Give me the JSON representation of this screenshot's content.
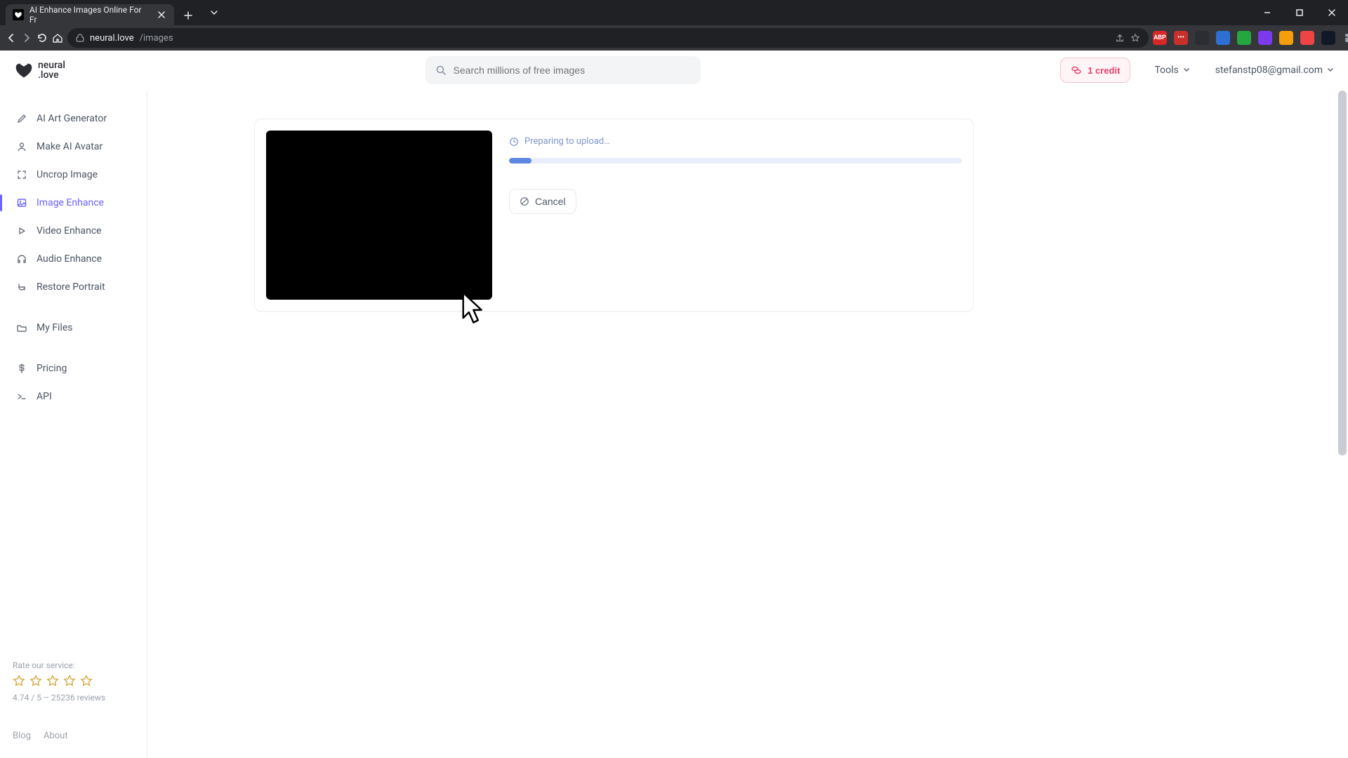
{
  "browser": {
    "tab_title": "AI Enhance Images Online For Fr",
    "url_host": "neural.love",
    "url_path": "/images"
  },
  "header": {
    "logo_line1": "neural",
    "logo_line2": ".love",
    "search_placeholder": "Search millions of free images",
    "credits_label": "1 credit",
    "tools_label": "Tools",
    "user_email": "stefanstp08@gmail.com"
  },
  "sidebar": {
    "items": [
      {
        "label": "AI Art Generator"
      },
      {
        "label": "Make AI Avatar"
      },
      {
        "label": "Uncrop Image"
      },
      {
        "label": "Image Enhance"
      },
      {
        "label": "Video Enhance"
      },
      {
        "label": "Audio Enhance"
      },
      {
        "label": "Restore Portrait"
      },
      {
        "label": "My Files"
      },
      {
        "label": "Pricing"
      },
      {
        "label": "API"
      }
    ],
    "rate_label": "Rate our service:",
    "rating_text": "4.74 / 5 – 25236 reviews",
    "footer": {
      "blog": "Blog",
      "about": "About"
    }
  },
  "upload": {
    "status_text": "Preparing to upload…",
    "cancel_label": "Cancel",
    "progress_percent": 5
  }
}
